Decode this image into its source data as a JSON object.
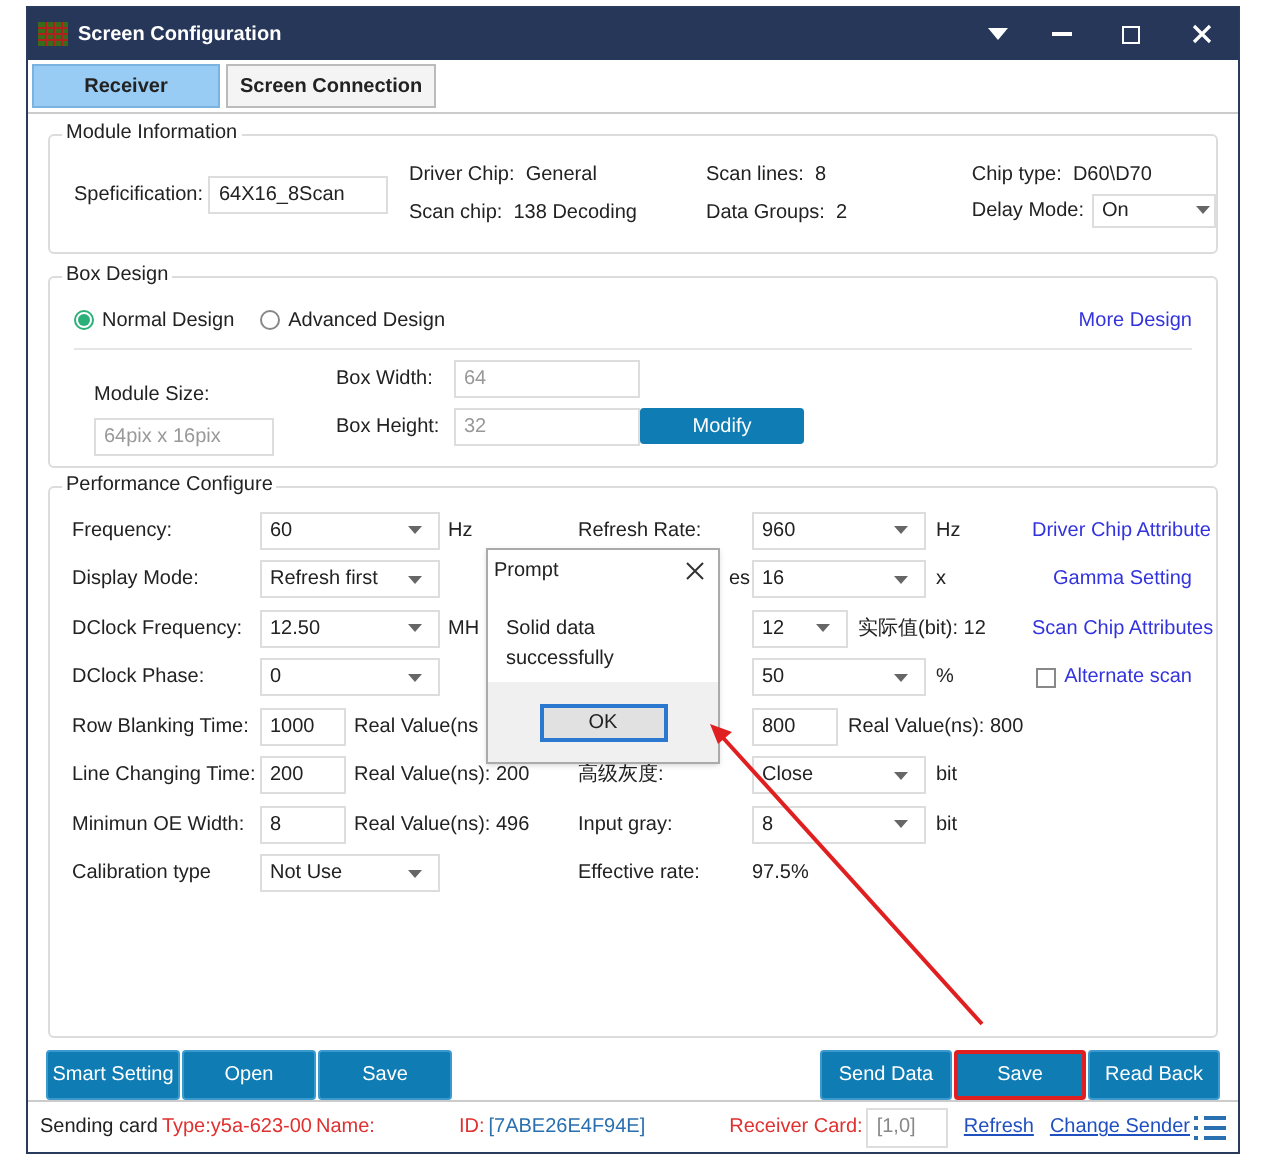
{
  "window": {
    "title": "Screen Configuration"
  },
  "tabs": [
    {
      "label": "Receiver",
      "selected": true
    },
    {
      "label": "Screen Connection",
      "selected": false
    }
  ],
  "module_info": {
    "title": "Module Information",
    "specification": {
      "label": "Speficification:",
      "value": "64X16_8Scan"
    },
    "columns": [
      [
        {
          "label": "Driver Chip:",
          "value": "General"
        },
        {
          "label": "Scan chip:",
          "value": "138 Decoding"
        }
      ],
      [
        {
          "label": "Scan lines:",
          "value": "8"
        },
        {
          "label": "Data Groups:",
          "value": "2"
        }
      ]
    ],
    "chip_type": {
      "label": "Chip type:",
      "value": "D60\\D70"
    },
    "delay_mode": {
      "label": "Delay Mode:",
      "value": "On"
    }
  },
  "box_design": {
    "title": "Box Design",
    "options": [
      {
        "label": "Normal Design",
        "selected": true
      },
      {
        "label": "Advanced Design",
        "selected": false
      }
    ],
    "link": "More Design",
    "module_size": {
      "label": "Module Size:",
      "value": "64pix x 16pix"
    },
    "box_width": {
      "label": "Box Width:",
      "value": "64"
    },
    "box_height": {
      "label": "Box Height:",
      "value": "32"
    },
    "modify_button": "Modify"
  },
  "performance": {
    "title": "Performance Configure",
    "rows": [
      {
        "left": {
          "label": "Frequency:",
          "kind": "select",
          "value": "60",
          "suffix": "Hz"
        },
        "mid": {
          "label": "Refresh Rate:",
          "kind": "select",
          "value": "960",
          "suffix": "Hz"
        },
        "right": {
          "kind": "link",
          "label": "Driver Chip Attribute"
        }
      },
      {
        "left": {
          "label": "Display Mode:",
          "kind": "select",
          "value": "Refresh first"
        },
        "mid": {
          "label": "es",
          "kind": "select",
          "value": "16",
          "suffix": "x"
        },
        "right": {
          "kind": "link",
          "label": "Gamma Setting"
        }
      },
      {
        "left": {
          "label": "DClock Frequency:",
          "kind": "select",
          "value": "12.50",
          "suffix": "MH"
        },
        "mid": {
          "kind": "small_select",
          "value": "12",
          "suffix": "实际值(bit): 12"
        },
        "right": {
          "kind": "link",
          "label": "Scan Chip Attributes"
        }
      },
      {
        "left": {
          "label": "DClock Phase:",
          "kind": "select",
          "value": "0"
        },
        "mid": {
          "kind": "select",
          "value": "50",
          "suffix": "%"
        },
        "right": {
          "kind": "checkbox",
          "label": "Alternate scan",
          "checked": false
        }
      },
      {
        "left": {
          "label": "Row Blanking Time:",
          "kind": "input",
          "value": "1000",
          "suffix": "Real Value(ns"
        },
        "mid": {
          "kind": "input",
          "value": "800",
          "suffix": "Real Value(ns): 800"
        }
      },
      {
        "left": {
          "label": "Line Changing Time:",
          "kind": "input",
          "value": "200",
          "suffix": "Real Value(ns): 200"
        },
        "mid": {
          "label": "高级灰度:",
          "kind": "select",
          "value": "Close",
          "suffix": "bit"
        }
      },
      {
        "left": {
          "label": "Minimun OE Width:",
          "kind": "input",
          "value": "8",
          "suffix": "Real Value(ns): 496"
        },
        "mid": {
          "label": "Input gray:",
          "kind": "select",
          "value": "8",
          "suffix": "bit"
        }
      },
      {
        "left": {
          "label": "Calibration type",
          "kind": "select",
          "value": "Not Use"
        },
        "mid": {
          "label": "Effective rate:",
          "kind": "text",
          "value": "97.5%"
        }
      }
    ]
  },
  "dialog": {
    "title": "Prompt",
    "message": "Solid data successfully",
    "ok_button": "OK"
  },
  "left_buttons": [
    {
      "label": "Smart Setting",
      "highlighted": false
    },
    {
      "label": "Open",
      "highlighted": false
    },
    {
      "label": "Save",
      "highlighted": false
    }
  ],
  "right_buttons": [
    {
      "label": "Send Data",
      "highlighted": false
    },
    {
      "label": "Save",
      "highlighted": true
    },
    {
      "label": "Read Back",
      "highlighted": false
    }
  ],
  "status_bar": [
    {
      "kind": "text",
      "text": "Sending card",
      "color": "#222222"
    },
    {
      "kind": "text",
      "text": "Type:y5a-623-00",
      "color": "#e03030"
    },
    {
      "kind": "text",
      "text": "Name:",
      "color": "#e03030"
    },
    {
      "kind": "spacer_text",
      "text": "ID:",
      "color": "#e03030"
    },
    {
      "kind": "text",
      "text": "[7ABE26E4F94E]",
      "color": "#2a6fb0"
    },
    {
      "kind": "spacer_text",
      "text": "Receiver Card:",
      "color": "#e03030"
    },
    {
      "kind": "field",
      "text": "[1,0]",
      "color": "#888888"
    },
    {
      "kind": "link",
      "text": "Refresh",
      "color": "#2050c0"
    },
    {
      "kind": "link",
      "text": "Change Sender",
      "color": "#2050c0"
    }
  ]
}
